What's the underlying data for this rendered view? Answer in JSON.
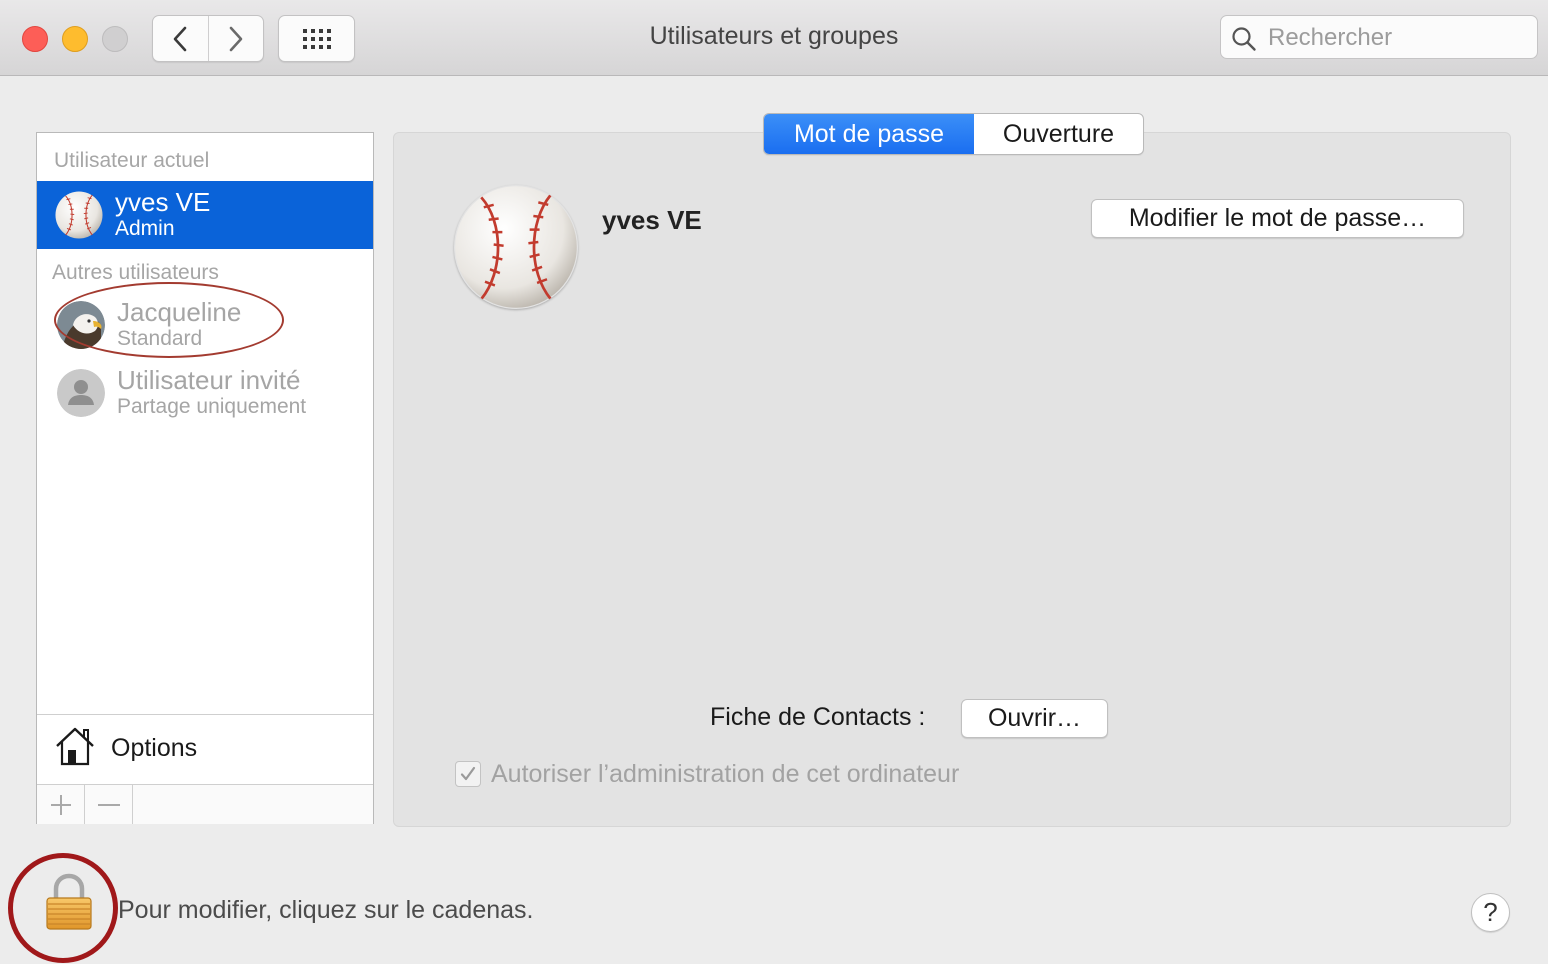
{
  "window": {
    "title": "Utilisateurs et groupes"
  },
  "toolbar": {
    "icons": [
      "chevron-left-icon",
      "chevron-right-icon",
      "grid-icon",
      "search-icon"
    ],
    "search_placeholder": "Rechercher"
  },
  "sidebar": {
    "current_section": "Utilisateur actuel",
    "current_user": {
      "name": "yves VE",
      "role": "Admin",
      "avatar": "baseball-icon"
    },
    "others_section": "Autres utilisateurs",
    "other_users": [
      {
        "name": "Jacqueline",
        "role": "Standard",
        "avatar": "eagle-icon"
      },
      {
        "name": "Utilisateur invité",
        "role": "Partage uniquement",
        "avatar": "person-icon"
      }
    ],
    "options_label": "Options",
    "add_symbol": "+",
    "remove_symbol": "—"
  },
  "tabs": [
    "Mot de passe",
    "Ouverture"
  ],
  "detail": {
    "user_name": "yves VE",
    "change_password_label": "Modifier le mot de passe…",
    "contacts_label": "Fiche de Contacts :",
    "open_label": "Ouvrir…",
    "admin_checkbox_label": "Autoriser l’administration de cet ordinateur",
    "admin_checked": true
  },
  "footer": {
    "lock_text": "Pour modifier, cliquez sur le cadenas.",
    "help_label": "?"
  },
  "colors": {
    "selection": "#0a63d9",
    "tab_active": "#1a6ef0",
    "annotation": "#a0181a"
  }
}
